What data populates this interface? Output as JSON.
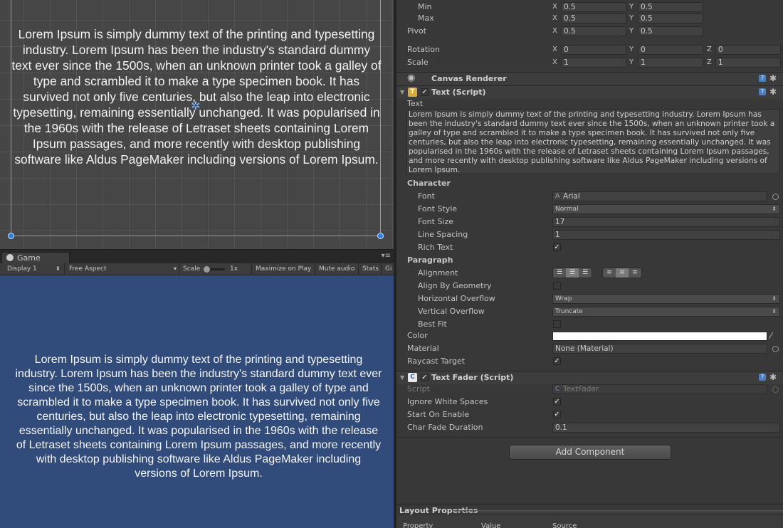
{
  "scene": {
    "text": "Lorem Ipsum is simply dummy text of the printing and typesetting industry. Lorem Ipsum has been the industry's standard dummy text ever since the 1500s, when an unknown printer took a galley of type and scrambled it to make a type specimen book. It has survived not only five centuries, but also the leap into electronic typesetting, remaining essentially unchanged. It was popularised in the 1960s with the release of Letraset sheets containing Lorem Ipsum passages, and more recently with desktop publishing software like Aldus PageMaker including versions of Lorem Ipsum."
  },
  "game": {
    "tab_label": "Game",
    "toolbar": {
      "display": "Display 1",
      "aspect": "Free Aspect",
      "scale_label": "Scale",
      "scale_value": "1x",
      "maximize": "Maximize on Play",
      "mute": "Mute audio",
      "stats": "Stats",
      "gizmos": "Gi"
    },
    "text": "Lorem Ipsum is simply dummy text of the printing and typesetting industry. Lorem Ipsum has been the industry's standard dummy text ever since the 1500s, when an unknown printer took a galley of type and scrambled it to make a type specimen book. It has survived not only five centuries, but also the leap into electronic typesetting, remaining essentially unchanged. It was popularised in the 1960s with the release of Letraset sheets containing Lorem Ipsum passages, and more recently with desktop publishing software like Aldus PageMaker including versions of Lorem Ipsum."
  },
  "inspector": {
    "rect": {
      "min_label": "Min",
      "min_x": "0.5",
      "min_y": "0.5",
      "max_label": "Max",
      "max_x": "0.5",
      "max_y": "0.5",
      "pivot_label": "Pivot",
      "pivot_x": "0.5",
      "pivot_y": "0.5",
      "rotation_label": "Rotation",
      "rot_x": "0",
      "rot_y": "0",
      "rot_z": "0",
      "scale_label": "Scale",
      "scale_x": "1",
      "scale_y": "1",
      "scale_z": "1",
      "axis_x": "X",
      "axis_y": "Y",
      "axis_z": "Z"
    },
    "canvas_renderer": {
      "title": "Canvas Renderer"
    },
    "text_script": {
      "title": "Text (Script)",
      "enabled": true,
      "text_label": "Text",
      "text_value": "Lorem Ipsum is simply dummy text of the printing and typesetting industry. Lorem Ipsum has been the industry's standard dummy text ever since the 1500s, when an unknown printer took a galley of type and scrambled it to make a type specimen book. It has survived not only five centuries, but also the leap into electronic typesetting, remaining essentially unchanged. It was popularised in the 1960s with the release of Letraset sheets containing Lorem Ipsum passages, and more recently with desktop publishing software like Aldus PageMaker including versions of Lorem Ipsum.",
      "character_label": "Character",
      "font_label": "Font",
      "font_value": "Arial",
      "font_style_label": "Font Style",
      "font_style_value": "Normal",
      "font_size_label": "Font Size",
      "font_size_value": "17",
      "line_spacing_label": "Line Spacing",
      "line_spacing_value": "1",
      "rich_text_label": "Rich Text",
      "rich_text": true,
      "paragraph_label": "Paragraph",
      "alignment_label": "Alignment",
      "align_by_geometry_label": "Align By Geometry",
      "align_by_geometry": false,
      "horizontal_overflow_label": "Horizontal Overflow",
      "horizontal_overflow_value": "Wrap",
      "vertical_overflow_label": "Vertical Overflow",
      "vertical_overflow_value": "Truncate",
      "best_fit_label": "Best Fit",
      "best_fit": false,
      "color_label": "Color",
      "color_value": "#ffffff",
      "material_label": "Material",
      "material_value": "None (Material)",
      "raycast_label": "Raycast Target",
      "raycast": true
    },
    "text_fader": {
      "title": "Text Fader (Script)",
      "enabled": true,
      "script_label": "Script",
      "script_value": "TextFader",
      "ignore_ws_label": "Ignore White Spaces",
      "ignore_ws": true,
      "start_on_enable_label": "Start On Enable",
      "start_on_enable": true,
      "char_fade_label": "Char Fade Duration",
      "char_fade_value": "0.1"
    },
    "add_component": "Add Component",
    "layout": {
      "title": "Layout Properties",
      "col_property": "Property",
      "col_value": "Value",
      "col_source": "Source"
    }
  },
  "colors": {
    "game_bg": "#314c7a",
    "scene_bg": "#464646",
    "handle": "#2f7fe0",
    "inspector_bg": "#383838"
  }
}
